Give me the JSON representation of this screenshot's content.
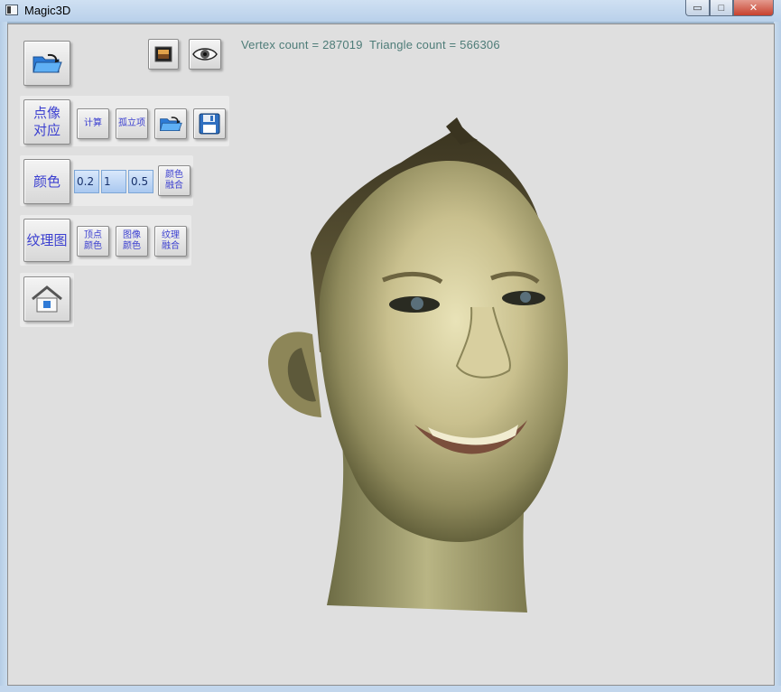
{
  "window": {
    "title": "Magic3D",
    "min_icon": "minimize-icon",
    "max_icon": "maximize-icon",
    "close_icon": "close-icon",
    "min_glyph": "▭",
    "max_glyph": "□",
    "close_glyph": "✕"
  },
  "viewport": {
    "stats": "Vertex count = 287019  Triangle count = 566306",
    "background": "#dfdfdf",
    "model_icon": "face-mesh"
  },
  "toolbar": {
    "open_icon": "folder-open-icon",
    "image_icon": "image-frame-icon",
    "eye_icon": "eye-icon",
    "point_match_label": "点像\n对应",
    "compute_label": "计算",
    "isolated_label": "孤立项",
    "open2_icon": "folder-open-icon",
    "save_icon": "floppy-disk-icon",
    "color_label": "颜色",
    "color_values": [
      "0.2",
      "1",
      "0.5"
    ],
    "color_blend_label": "颜色\n融合",
    "texture_label": "纹理图",
    "vertex_color_label": "顶点\n颜色",
    "image_color_label": "图像\n颜色",
    "texture_blend_label": "纹理\n融合",
    "home_icon": "home-icon"
  },
  "colors": {
    "label_text": "#3b3fd0",
    "stats_text": "#4e7c78",
    "close_button": "#c7412e"
  }
}
